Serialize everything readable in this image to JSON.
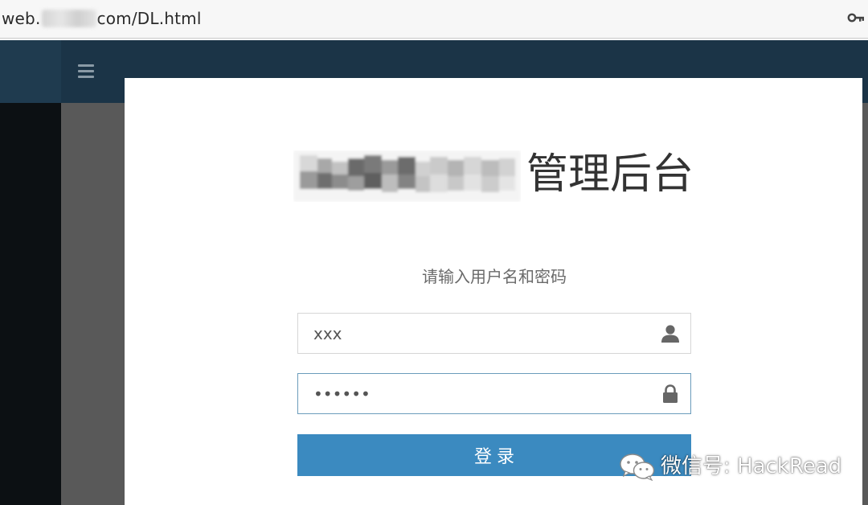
{
  "browser": {
    "url_prefix": "web.",
    "url_suffix": "com/DL.html",
    "key_icon": "key-icon"
  },
  "header": {
    "menu_icon": "hamburger-icon"
  },
  "login": {
    "title": "管理后台",
    "subtitle": "请输入用户名和密码",
    "username_value": "xxx",
    "password_value": "••••••",
    "username_icon": "user-icon",
    "password_icon": "lock-icon",
    "submit_label": "登录"
  },
  "watermark": {
    "text": "微信号: HackRead",
    "icon": "wechat-icon"
  },
  "colors": {
    "topbar": "#1b3447",
    "sidebar": "#0c1013",
    "overlay": "#595959",
    "button": "#3b8ac0",
    "focus_border": "#6b9cbb"
  }
}
